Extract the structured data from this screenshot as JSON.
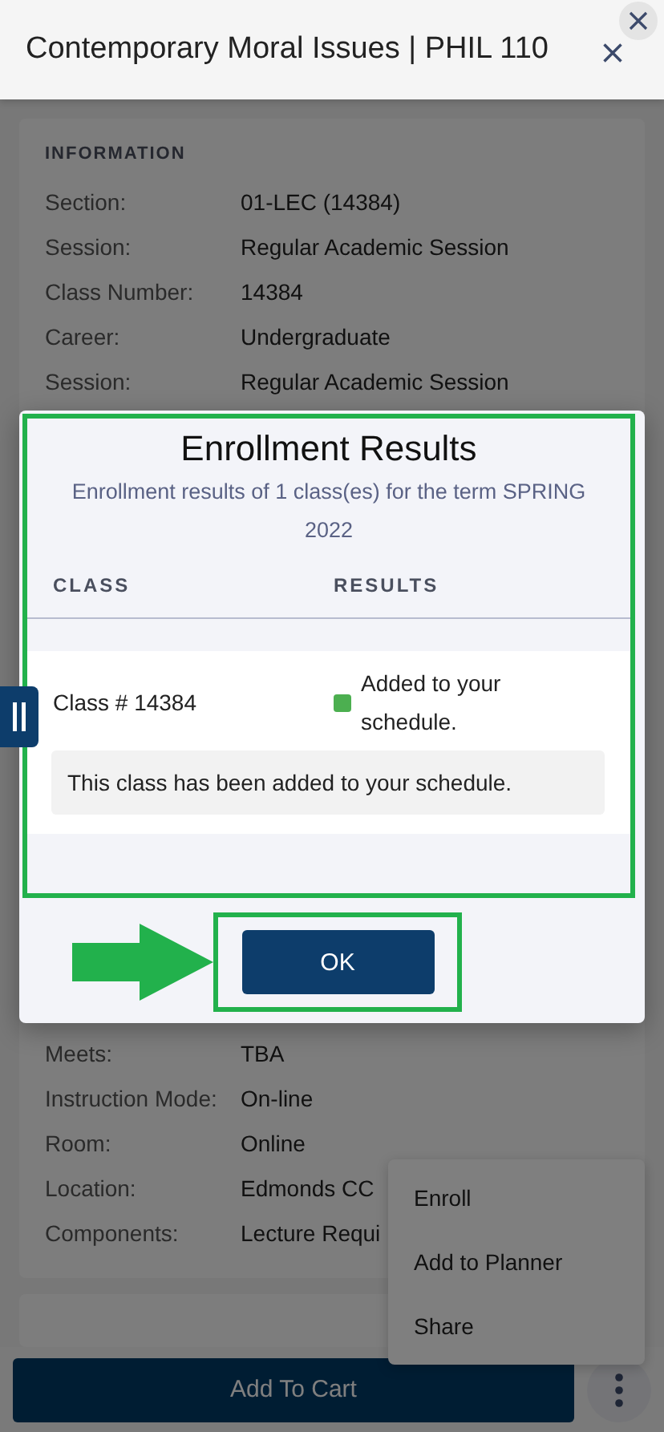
{
  "header": {
    "title": "Contemporary Moral Issues | PHIL 110"
  },
  "information": {
    "heading": "INFORMATION",
    "rows_top": [
      {
        "label": "Section:",
        "value": "01-LEC (14384)"
      },
      {
        "label": "Session:",
        "value": "Regular Academic Session"
      },
      {
        "label": "Class Number:",
        "value": "14384"
      },
      {
        "label": "Career:",
        "value": "Undergraduate"
      },
      {
        "label": "Session:",
        "value": "Regular Academic Session"
      }
    ],
    "rows_bottom": [
      {
        "label": "Meets:",
        "value": "TBA"
      },
      {
        "label": "Instruction Mode:",
        "value": "On-line"
      },
      {
        "label": "Room:",
        "value": "Online"
      },
      {
        "label": "Location:",
        "value": "Edmonds CC"
      },
      {
        "label": "Components:",
        "value": "Lecture Requi"
      }
    ]
  },
  "modal": {
    "title": "Enrollment Results",
    "subtitle": "Enrollment results of 1 class(es) for the term SPRING 2022",
    "columns": [
      "CLASS",
      "RESULTS"
    ],
    "results": [
      {
        "class": "Class # 14384",
        "status": "Added to your schedule.",
        "color": "#4caf50",
        "message": "This class has been added to your schedule."
      }
    ],
    "button": "OK"
  },
  "menu": {
    "items": [
      "Enroll",
      "Add to Planner",
      "Share"
    ]
  },
  "footer": {
    "button": "Add To Cart"
  }
}
